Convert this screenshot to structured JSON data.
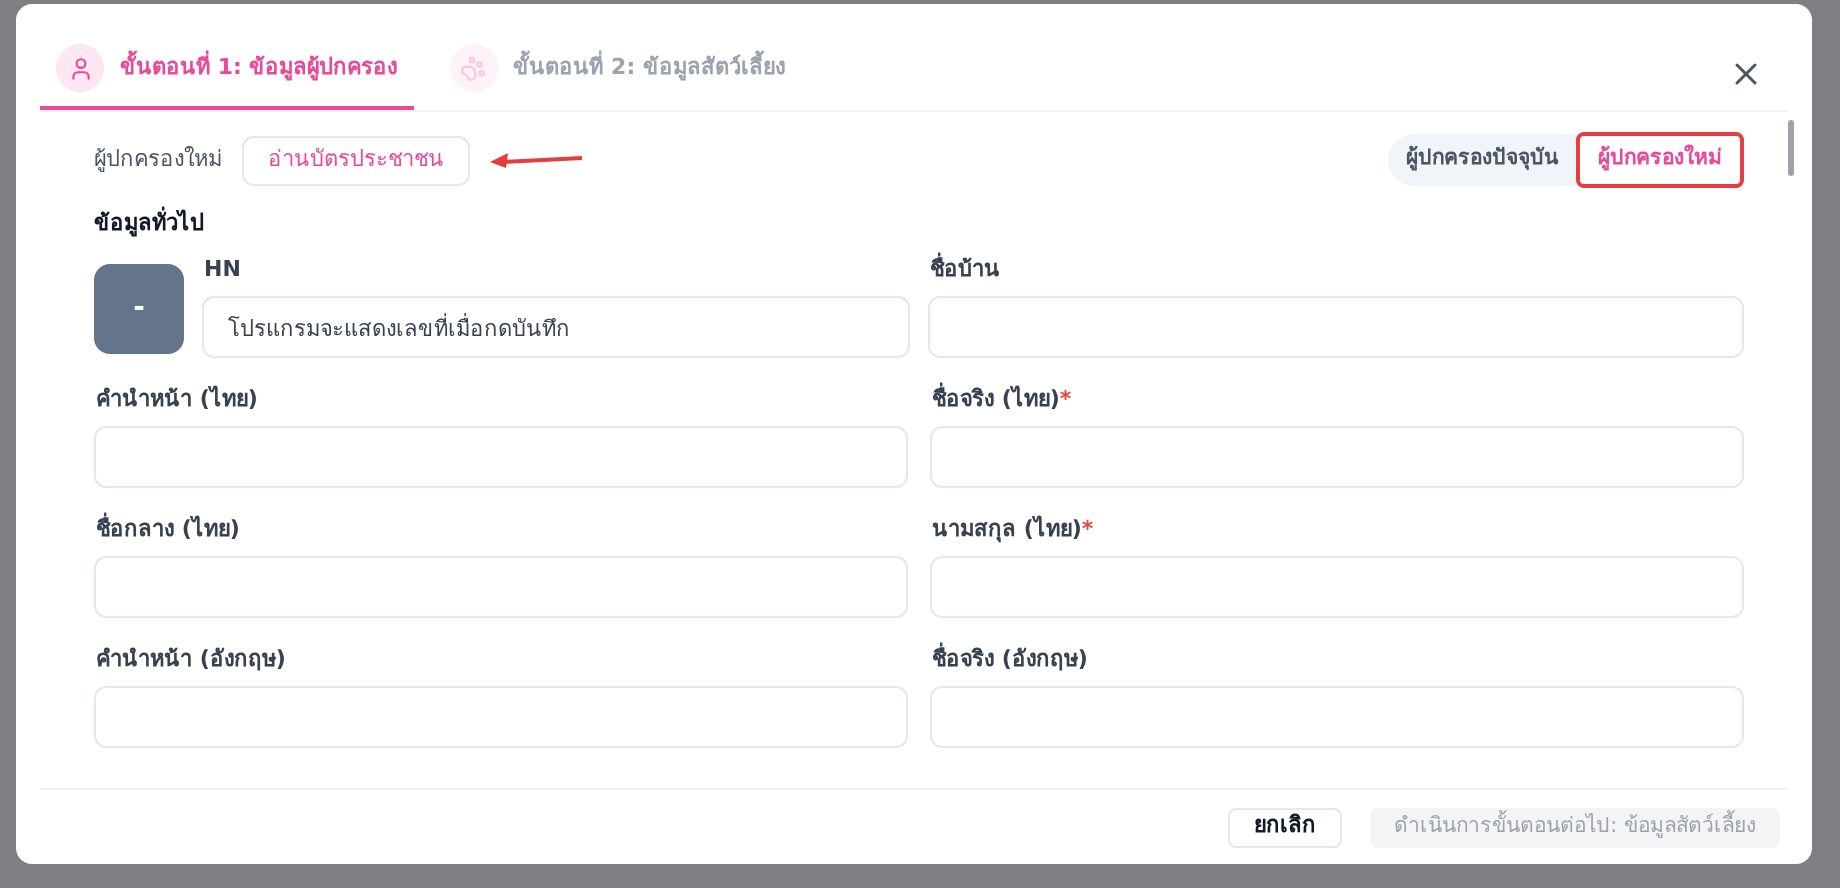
{
  "steps": [
    {
      "label": "ขั้นตอนที่ 1: ข้อมูลผู้ปกครอง",
      "kind": "person",
      "selected": true
    },
    {
      "label": "ขั้นตอนที่ 2: ข้อมูลสัตว์เลี้ยง",
      "kind": "paw",
      "selected": false
    }
  ],
  "owner_bar": {
    "label": "ผู้ปกครองใหม่",
    "read_card_button": "อ่านบัตรประชาชน"
  },
  "owner_toggle": [
    {
      "label": "ผู้ปกครองปัจจุบัน",
      "selected": false
    },
    {
      "label": "ผู้ปกครองใหม่",
      "selected": true
    }
  ],
  "section_title": "ข้อมูลทั่วไป",
  "avatar": {
    "text": "-"
  },
  "fields": [
    {
      "label": "HN",
      "value": "โปรแกรมจะแสดงเลขที่เมื่อกดบันทึก"
    },
    {
      "label": "ชื่อบ้าน"
    },
    {
      "label": "คำนำหน้า (ไทย)"
    },
    {
      "label": "ชื่อจริง (ไทย)",
      "required_mark": "*"
    },
    {
      "label": "ชื่อกลาง (ไทย)"
    },
    {
      "label": "นามสกุล (ไทย)",
      "required_mark": "*"
    },
    {
      "label": "คำนำหน้า (อังกฤษ)"
    },
    {
      "label": "ชื่อจริง (อังกฤษ)"
    }
  ],
  "footer": {
    "cancel": "ยกเลิก",
    "next": {
      "label": "ดำเนินการขั้นตอนต่อไป: ข้อมูลสัตว์เลี้ยง",
      "disabled": true
    }
  }
}
